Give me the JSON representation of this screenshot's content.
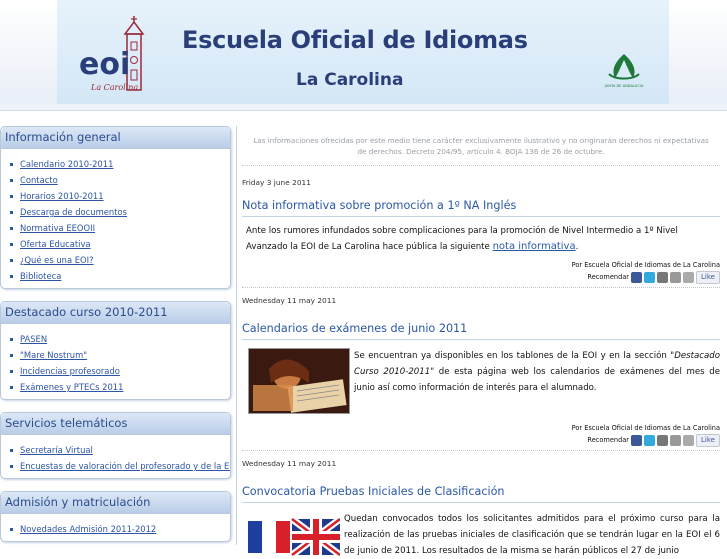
{
  "header": {
    "title": "Escuela Oficial de Idiomas",
    "subtitle": "La Carolina",
    "logo_text": "eoi",
    "logo_script": "La Carolina",
    "junta_text": "JUNTA DE ANDALUCIA"
  },
  "sidebar": {
    "sections": [
      {
        "title": "Información general",
        "items": [
          "Calendario 2010-2011",
          "Contacto",
          "Horarios 2010-2011",
          "Descarga de documentos",
          "Normativa EEOOII",
          "Oferta Educativa",
          "¿Qué es una EOI?",
          "Biblioteca"
        ]
      },
      {
        "title": "Destacado curso 2010-2011",
        "items": [
          "PASEN",
          "\"Mare Nostrum\"",
          "Incidencias profesorado",
          "Exámenes y PTECs 2011"
        ]
      },
      {
        "title": "Servicios telemáticos",
        "items": [
          "Secretaría Virtual",
          "Encuestas de valoración del profesorado y de la EOI."
        ]
      },
      {
        "title": "Admisión y matriculación",
        "items": [
          "Novedades Admisión 2011-2012"
        ]
      }
    ]
  },
  "main": {
    "disclaimer": "Las informaciones ofrecidas por este medio tiene carácter exclusivamente ilustrativo y no originarán derechos ni expectativas de derechos. Decreto 204/95, artículo 4. BOJA 136 de 26 de octubre.",
    "author_line": "Por Escuela Oficial de Idiomas de La Carolina",
    "recommend_label": "Recomendar",
    "like_label": "Like",
    "posts": [
      {
        "date": "Friday 3 june 2011",
        "title": "Nota informativa sobre promoción a 1º NA Inglés",
        "text": "Ante los rumores infundados sobre complicaciones para la promoción de Nivel Intermedio a 1º Nivel Avanzado la EOI de La Carolina  hace pública la siguiente",
        "link": "nota informativa",
        "text_end": "."
      },
      {
        "date": "Wednesday 11 may 2011",
        "title": "Calendarios de exámenes de junio 2011",
        "text_a": "Se encuentran ya disponibles en los tablones de la EOI y en la sección \"",
        "text_em": "Destacado Curso 2010-2011",
        "text_b": "\" de esta página web los calendarios de exámenes del mes de junio así como información de interés para el alumnado."
      },
      {
        "date": "Wednesday 11 may 2011",
        "title": "Convocatoria Pruebas Iniciales de Clasificación",
        "text": "Quedan convocados todos los solicitantes admitidos para el próximo curso para la realización de las pruebas iniciales de clasificación que se tendrán lugar en la EOI el 6 de junio de 2011. Los resultados de la misma se harán públicos el 27 de junio"
      }
    ]
  },
  "colors": {
    "accent": "#2a58a5",
    "title": "#2a3f7a",
    "box_border": "#b8c8dd"
  }
}
